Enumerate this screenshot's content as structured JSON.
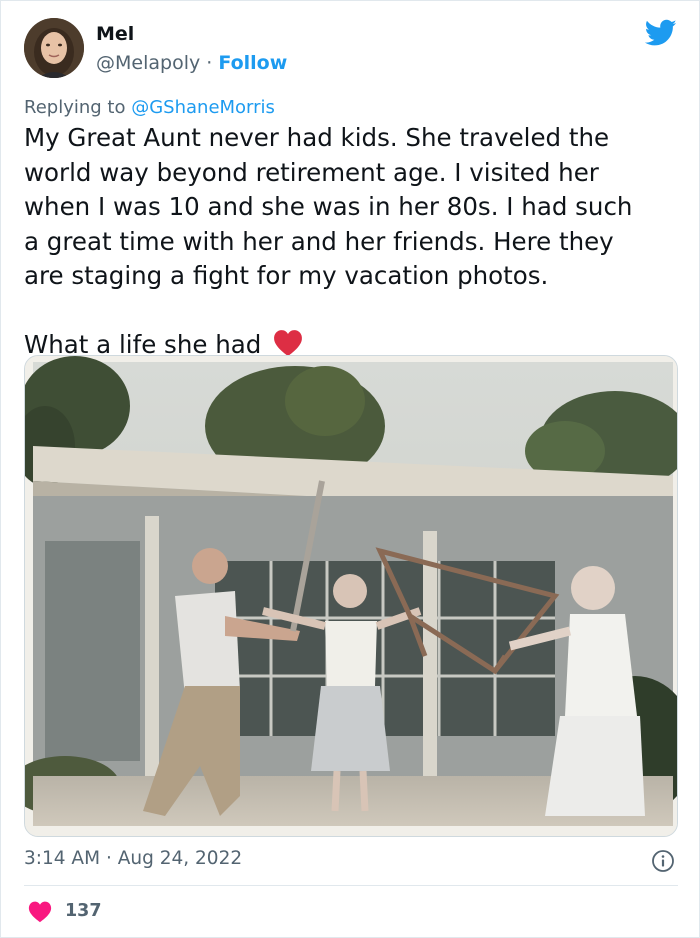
{
  "author": {
    "name": "Mel",
    "handle": "@Melapoly",
    "separator": "·",
    "follow_label": "Follow",
    "avatar_icon": "profile-photo"
  },
  "platform_icon": "twitter-bird-icon",
  "reply": {
    "prefix": "Replying to",
    "mention": "@GShaneMorris"
  },
  "tweet": {
    "lines": [
      "My Great Aunt never had kids. She traveled the",
      "world way beyond retirement age. I visited her",
      "when I was 10 and she was in her 80s. I had such",
      "a great time with her and her friends. Here they",
      "are staging a fight for my vacation photos."
    ],
    "closing": "What a life she had",
    "closing_emoji": "red-heart"
  },
  "photo": {
    "icon": "vacation-photo"
  },
  "meta": {
    "time": "3:14 AM",
    "separator": "·",
    "date": "Aug 24, 2022",
    "info_icon": "info-icon"
  },
  "engagement": {
    "likes": "137",
    "like_icon": "heart-icon"
  },
  "colors": {
    "accent": "#1d9bf0",
    "text": "#0f1419",
    "secondary": "#536471",
    "heart": "#f91880"
  }
}
